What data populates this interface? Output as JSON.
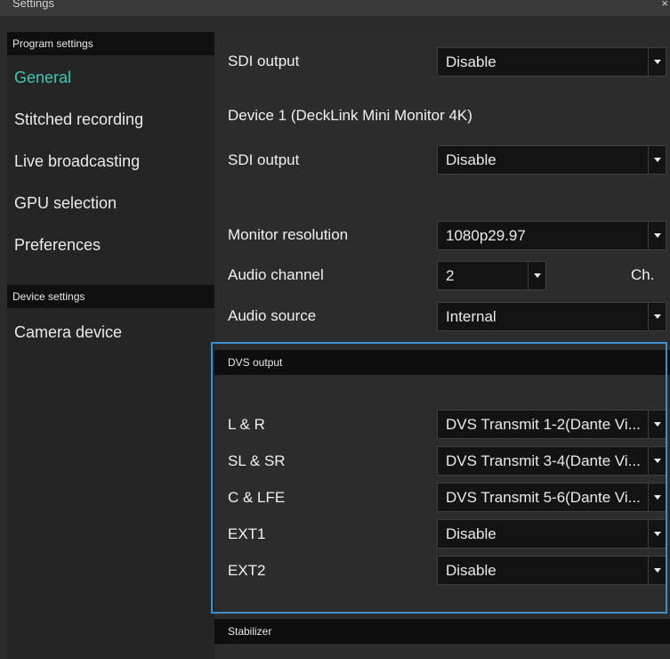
{
  "window": {
    "title": "Settings",
    "close_label": "×"
  },
  "sidebar": {
    "program_settings_label": "Program settings",
    "program_items": [
      {
        "label": "General",
        "active": true
      },
      {
        "label": "Stitched recording",
        "active": false
      },
      {
        "label": "Live broadcasting",
        "active": false
      },
      {
        "label": "GPU selection",
        "active": false
      },
      {
        "label": "Preferences",
        "active": false
      }
    ],
    "device_settings_label": "Device settings",
    "device_items": [
      {
        "label": "Camera device",
        "active": false
      }
    ]
  },
  "main": {
    "sdi_output_top": {
      "label": "SDI output",
      "value": "Disable"
    },
    "device_heading": "Device 1 (DeckLink Mini Monitor 4K)",
    "sdi_output_device": {
      "label": "SDI output",
      "value": "Disable"
    },
    "monitor_resolution": {
      "label": "Monitor resolution",
      "value": "1080p29.97"
    },
    "audio_channel": {
      "label": "Audio channel",
      "value": "2",
      "unit": "Ch."
    },
    "audio_source": {
      "label": "Audio source",
      "value": "Internal"
    },
    "dvs_output": {
      "header": "DVS output",
      "rows": [
        {
          "label": "L & R",
          "value": "DVS Transmit  1-2(Dante Vi..."
        },
        {
          "label": "SL & SR",
          "value": "DVS Transmit  3-4(Dante Vi..."
        },
        {
          "label": "C & LFE",
          "value": "DVS Transmit  5-6(Dante Vi..."
        },
        {
          "label": "EXT1",
          "value": "Disable"
        },
        {
          "label": "EXT2",
          "value": "Disable"
        }
      ]
    },
    "stabilizer_header": "Stabilizer"
  },
  "colors": {
    "accent_active": "#3fc7b6",
    "highlight_border": "#3c8fd0",
    "background": "#2b2b2b"
  }
}
